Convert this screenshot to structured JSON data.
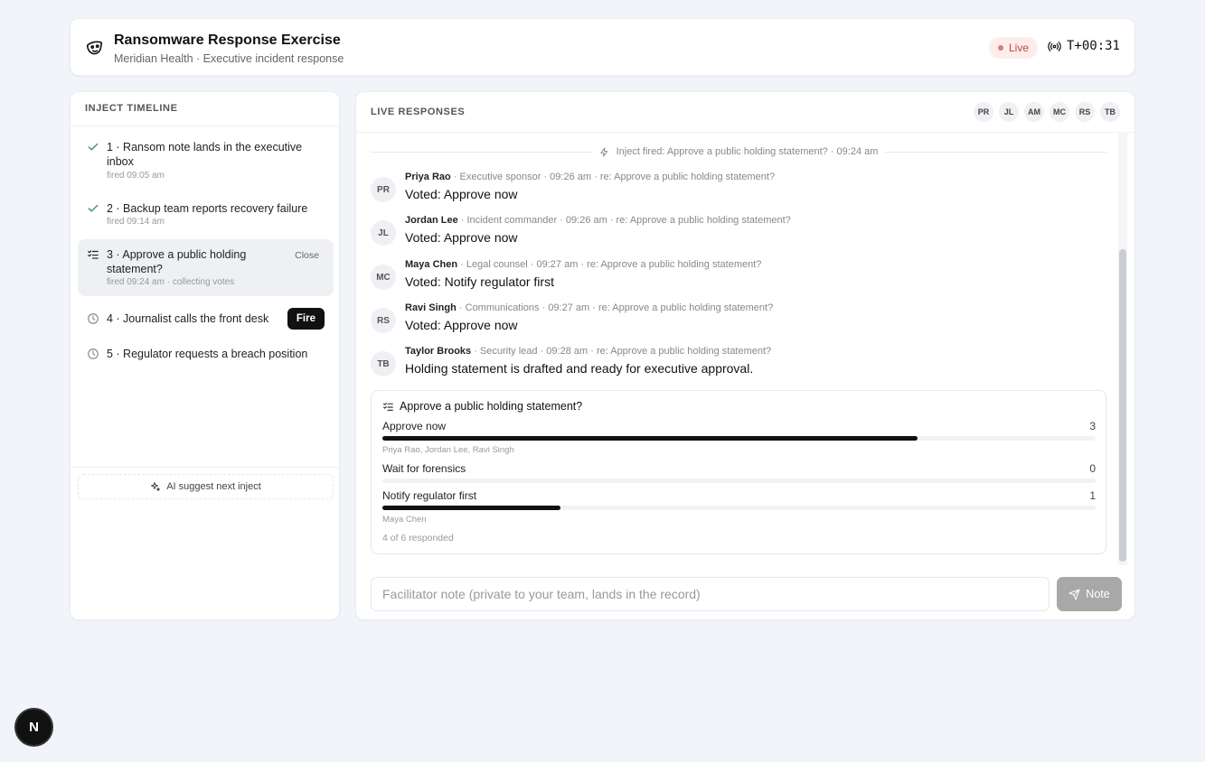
{
  "header": {
    "title": "Ransomware Response Exercise",
    "subtitle": "Meridian Health · Executive incident response",
    "live_label": "Live",
    "timer": "T+00:31",
    "logo_icon": "mask-icon",
    "live_color": "#c0453a"
  },
  "timeline": {
    "heading": "Inject Timeline",
    "injects": [
      {
        "label": "1 · Ransom note lands in the executive inbox",
        "meta": "fired 09:05 am",
        "icon": "check-icon"
      },
      {
        "label": "2 · Backup team reports recovery failure",
        "meta": "fired 09:14 am",
        "icon": "check-icon"
      },
      {
        "label": "3 · Approve a public holding statement?",
        "meta": "fired 09:24 am · collecting votes",
        "icon": "poll-icon",
        "action": "Close"
      },
      {
        "label": "4 · Journalist calls the front desk",
        "icon": "clock-icon",
        "action": "Fire"
      },
      {
        "label": "5 · Regulator requests a breach position",
        "icon": "clock-icon"
      }
    ],
    "suggest_label": "AI suggest next inject"
  },
  "responses": {
    "heading": "Live Responses",
    "participants": [
      "PR",
      "JL",
      "AM",
      "MC",
      "RS",
      "TB"
    ],
    "fired_notice": "Inject fired: Approve a public holding statement? · 09:24 am",
    "messages": [
      {
        "initials": "PR",
        "name": "Priya Rao",
        "meta": "· Executive sponsor · 09:26 am · re: Approve a public holding statement?",
        "prefix": "Voted: ",
        "body": "Approve now"
      },
      {
        "initials": "JL",
        "name": "Jordan Lee",
        "meta": "· Incident commander · 09:26 am · re: Approve a public holding statement?",
        "prefix": "Voted: ",
        "body": "Approve now"
      },
      {
        "initials": "MC",
        "name": "Maya Chen",
        "meta": "· Legal counsel · 09:27 am · re: Approve a public holding statement?",
        "prefix": "Voted: ",
        "body": "Notify regulator first"
      },
      {
        "initials": "RS",
        "name": "Ravi Singh",
        "meta": "· Communications · 09:27 am · re: Approve a public holding statement?",
        "prefix": "Voted: ",
        "body": "Approve now"
      },
      {
        "initials": "TB",
        "name": "Taylor Brooks",
        "meta": "· Security lead · 09:28 am · re: Approve a public holding statement?",
        "prefix": "",
        "body": "Holding statement is drafted and ready for executive approval."
      }
    ],
    "poll": {
      "title": "Approve a public holding statement?",
      "options": [
        {
          "label": "Approve now",
          "count": "3",
          "fraction": 0.75,
          "voters": "Priya Rao, Jordan Lee, Ravi Singh"
        },
        {
          "label": "Wait for forensics",
          "count": "0",
          "fraction": 0,
          "voters": ""
        },
        {
          "label": "Notify regulator first",
          "count": "1",
          "fraction": 0.25,
          "voters": "Maya Chen"
        }
      ],
      "footer": "4 of 6 responded"
    },
    "note_placeholder": "Facilitator note (private to your team, lands in the record)",
    "note_button": "Note"
  },
  "corner_badge": "N"
}
